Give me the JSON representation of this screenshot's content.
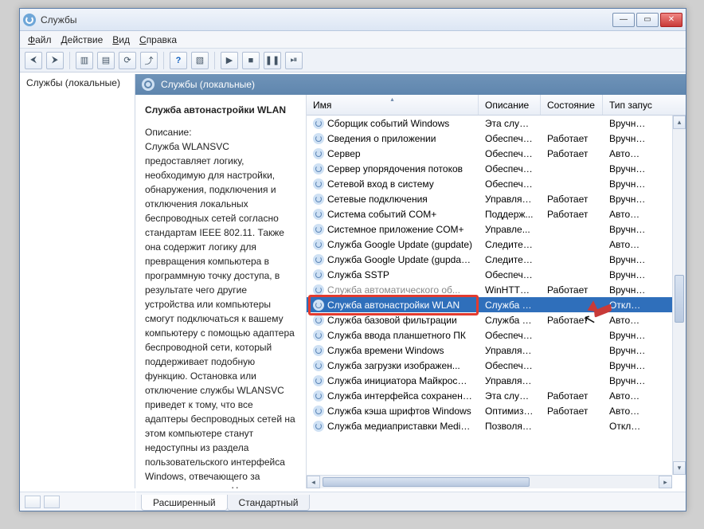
{
  "window": {
    "title": "Службы"
  },
  "menu": [
    "Файл",
    "Действие",
    "Вид",
    "Справка"
  ],
  "leftpane": {
    "root": "Службы (локальные)"
  },
  "subheader": "Службы (локальные)",
  "detail": {
    "heading": "Служба автонастройки WLAN",
    "desc_label": "Описание:",
    "description": "Служба WLANSVC предоставляет логику, необходимую для настройки, обнаружения, подключения и отключения локальных беспроводных сетей согласно стандартам IEEE 802.11. Также она содержит логику для превращения компьютера в программную точку доступа, в результате чего другие устройства или компьютеры смогут подключаться к вашему компьютеру с помощью адаптера беспроводной сети, который поддерживает подобную функцию. Остановка или отключение службы WLANSVC приведет к тому, что все адаптеры беспроводных сетей на этом компьютере станут недоступны из раздела пользовательского интерфейса Windows, отвечающего за управление сетью. Настоятельно рекомендуется"
  },
  "columns": {
    "name": "Имя",
    "desc": "Описание",
    "state": "Состояние",
    "start": "Тип запус"
  },
  "rows": [
    {
      "name": "Сборщик событий Windows",
      "desc": "Эта служб...",
      "state": "",
      "start": "Вручную"
    },
    {
      "name": "Сведения о приложении",
      "desc": "Обеспечи...",
      "state": "Работает",
      "start": "Вручную"
    },
    {
      "name": "Сервер",
      "desc": "Обеспечи...",
      "state": "Работает",
      "start": "Автомати"
    },
    {
      "name": "Сервер упорядочения потоков",
      "desc": "Обеспечи...",
      "state": "",
      "start": "Вручную"
    },
    {
      "name": "Сетевой вход в систему",
      "desc": "Обеспечи...",
      "state": "",
      "start": "Вручную"
    },
    {
      "name": "Сетевые подключения",
      "desc": "Управляе...",
      "state": "Работает",
      "start": "Вручную"
    },
    {
      "name": "Система событий COM+",
      "desc": "Поддерж...",
      "state": "Работает",
      "start": "Автомати"
    },
    {
      "name": "Системное приложение COM+",
      "desc": "Управле...",
      "state": "",
      "start": "Вручную"
    },
    {
      "name": "Служба Google Update (gupdate)",
      "desc": "Следите за...",
      "state": "",
      "start": "Автомати"
    },
    {
      "name": "Служба Google Update (gupdatem)",
      "desc": "Следите за...",
      "state": "",
      "start": "Вручную"
    },
    {
      "name": "Служба SSTP",
      "desc": "Обеспечи...",
      "state": "",
      "start": "Вручную"
    },
    {
      "name": "Служба автоматического об...",
      "desc": "WinHTTP ...",
      "state": "Работает",
      "start": "Вручную",
      "obscured": true
    },
    {
      "name": "Служба автонастройки WLAN",
      "desc": "Служба W...",
      "state": "",
      "start": "Отключен",
      "selected": true
    },
    {
      "name": "Служба базовой фильтрации",
      "desc": "Служба ба...",
      "state": "Работает",
      "start": "Автомати"
    },
    {
      "name": "Служба ввода планшетного ПК",
      "desc": "Обеспечи...",
      "state": "",
      "start": "Вручную"
    },
    {
      "name": "Служба времени Windows",
      "desc": "Управляе...",
      "state": "",
      "start": "Вручную"
    },
    {
      "name": "Служба загрузки изображен...",
      "desc": "Обеспечи...",
      "state": "",
      "start": "Вручную"
    },
    {
      "name": "Служба инициатора Майкрософ...",
      "desc": "Управляе...",
      "state": "",
      "start": "Вручную"
    },
    {
      "name": "Служба интерфейса сохранени...",
      "desc": "Эта служб...",
      "state": "Работает",
      "start": "Автомати"
    },
    {
      "name": "Служба кэша шрифтов Windows",
      "desc": "Оптимизи...",
      "state": "Работает",
      "start": "Автомати"
    },
    {
      "name": "Служба медиапристaвки Media C...",
      "desc": "Позволяет...",
      "state": "",
      "start": "Отключен"
    }
  ],
  "tabs": {
    "extended": "Расширенный",
    "standard": "Стандартный"
  }
}
